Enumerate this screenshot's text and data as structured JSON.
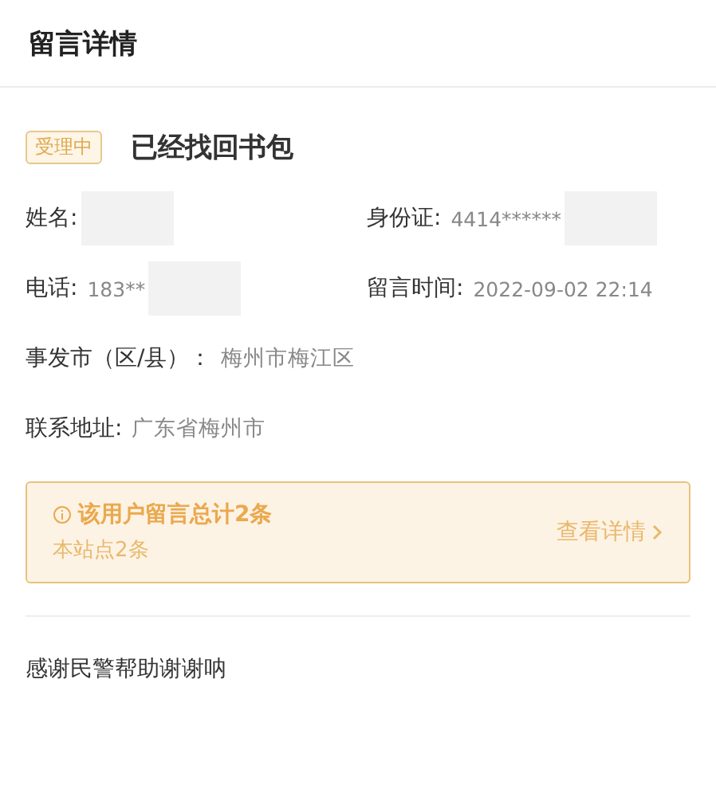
{
  "header": {
    "title": "留言详情"
  },
  "status": {
    "label": "受理中"
  },
  "subject": "已经找回书包",
  "fields": [
    {
      "label": "姓名:",
      "redacted": true
    },
    {
      "label": "身份证:",
      "value": "4414******",
      "redacted": true
    },
    {
      "label": "电话:",
      "value": "183**",
      "redacted": true
    },
    {
      "label": "留言时间:",
      "value": "2022-09-02 22:14",
      "redacted": false
    }
  ],
  "full_fields": [
    {
      "label": "事发市（区/县）：",
      "value": "梅州市梅江区"
    },
    {
      "label": "联系地址:",
      "value": "广东省梅州市"
    }
  ],
  "notice": {
    "title": "该用户留言总计2条",
    "subtitle": "本站点2条",
    "link": "查看详情"
  },
  "message": "感谢民警帮助谢谢呐"
}
